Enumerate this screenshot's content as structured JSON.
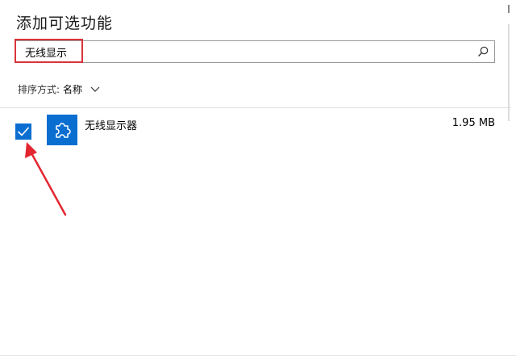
{
  "dialog": {
    "title": "添加可选功能"
  },
  "search": {
    "value": "无线显示",
    "placeholder": ""
  },
  "sort": {
    "label": "排序方式:",
    "value": "名称"
  },
  "features": [
    {
      "name": "无线显示器",
      "size": "1.95 MB",
      "checked": true
    }
  ],
  "colors": {
    "accent": "#0a6ed1",
    "highlight": "#d9343b"
  },
  "icons": {
    "search": "search-icon",
    "sort": "chevron-down-icon",
    "feature": "puzzle-icon",
    "check": "checkmark-icon"
  }
}
